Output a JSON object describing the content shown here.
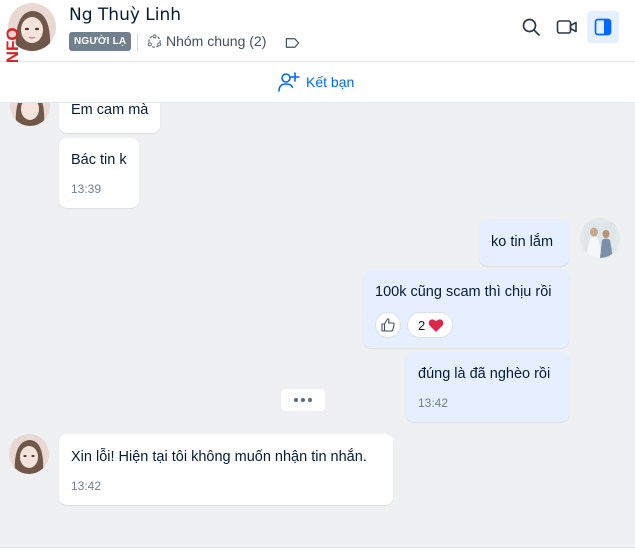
{
  "header": {
    "contact_name": "Ng Thuỳ Linh",
    "stranger_badge": "NGƯỜI LẠ",
    "mutual_groups": "Nhóm chung (2)",
    "watermark": "INFO"
  },
  "friend_bar": {
    "add_friend_label": "Kết bạn"
  },
  "messages": {
    "m1": {
      "text": "Em cam mà"
    },
    "m2": {
      "text": "Bác tin k",
      "time": "13:39"
    },
    "m3": {
      "text": "ko tin lắm"
    },
    "m4": {
      "text": "100k cũng scam thì chịu rồi",
      "reaction_count": "2"
    },
    "m5": {
      "text": "đúng là đã nghèo rồi",
      "time": "13:42"
    },
    "m6": {
      "text": "Xin lỗi! Hiện tại tôi không muốn nhận tin nhắn.",
      "time": "13:42"
    }
  },
  "colors": {
    "accent": "#0068ff",
    "my_bubble": "#e5efff",
    "background": "#eef0f1",
    "heart": "#e0254b"
  }
}
